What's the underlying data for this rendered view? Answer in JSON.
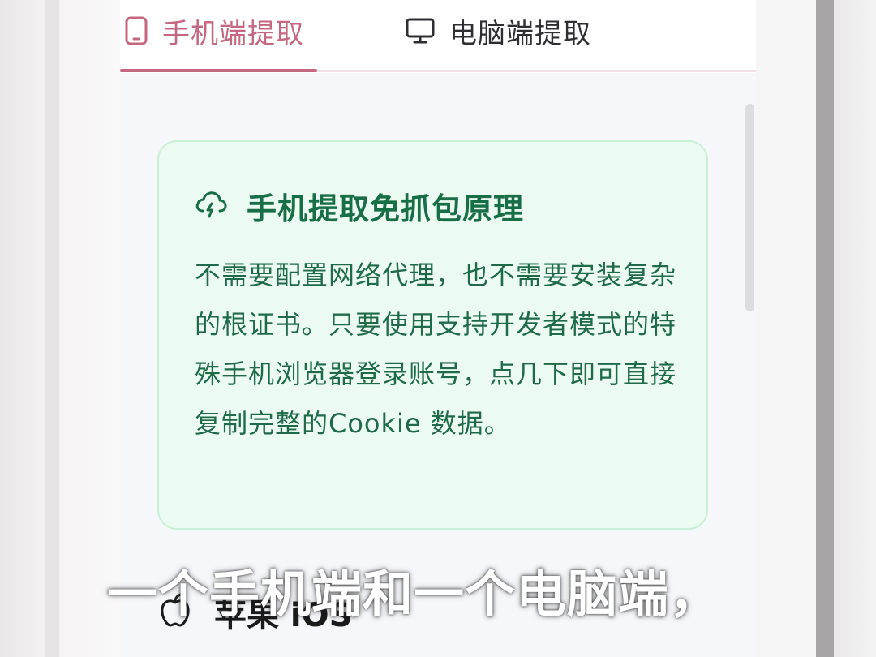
{
  "tabs": [
    {
      "label": "手机端提取",
      "icon": "phone-icon",
      "active": true
    },
    {
      "label": "电脑端提取",
      "icon": "monitor-icon",
      "active": false
    }
  ],
  "card": {
    "icon": "cloud-lightning-icon",
    "title": "手机提取免抓包原理",
    "body": "不需要配置网络代理，也不需要安装复杂的根证书。只要使用支持开发者模式的特殊手机浏览器登录账号，点几下即可直接复制完整的Cookie 数据。"
  },
  "section": {
    "icon": "apple-icon",
    "label": "苹果 iOS"
  },
  "subtitle": "一个手机端和一个电脑端，",
  "colors": {
    "accent": "#c4677f",
    "card_bg": "#ecfbf1",
    "card_border": "#c8f0d6",
    "card_text": "#1f6a49"
  }
}
